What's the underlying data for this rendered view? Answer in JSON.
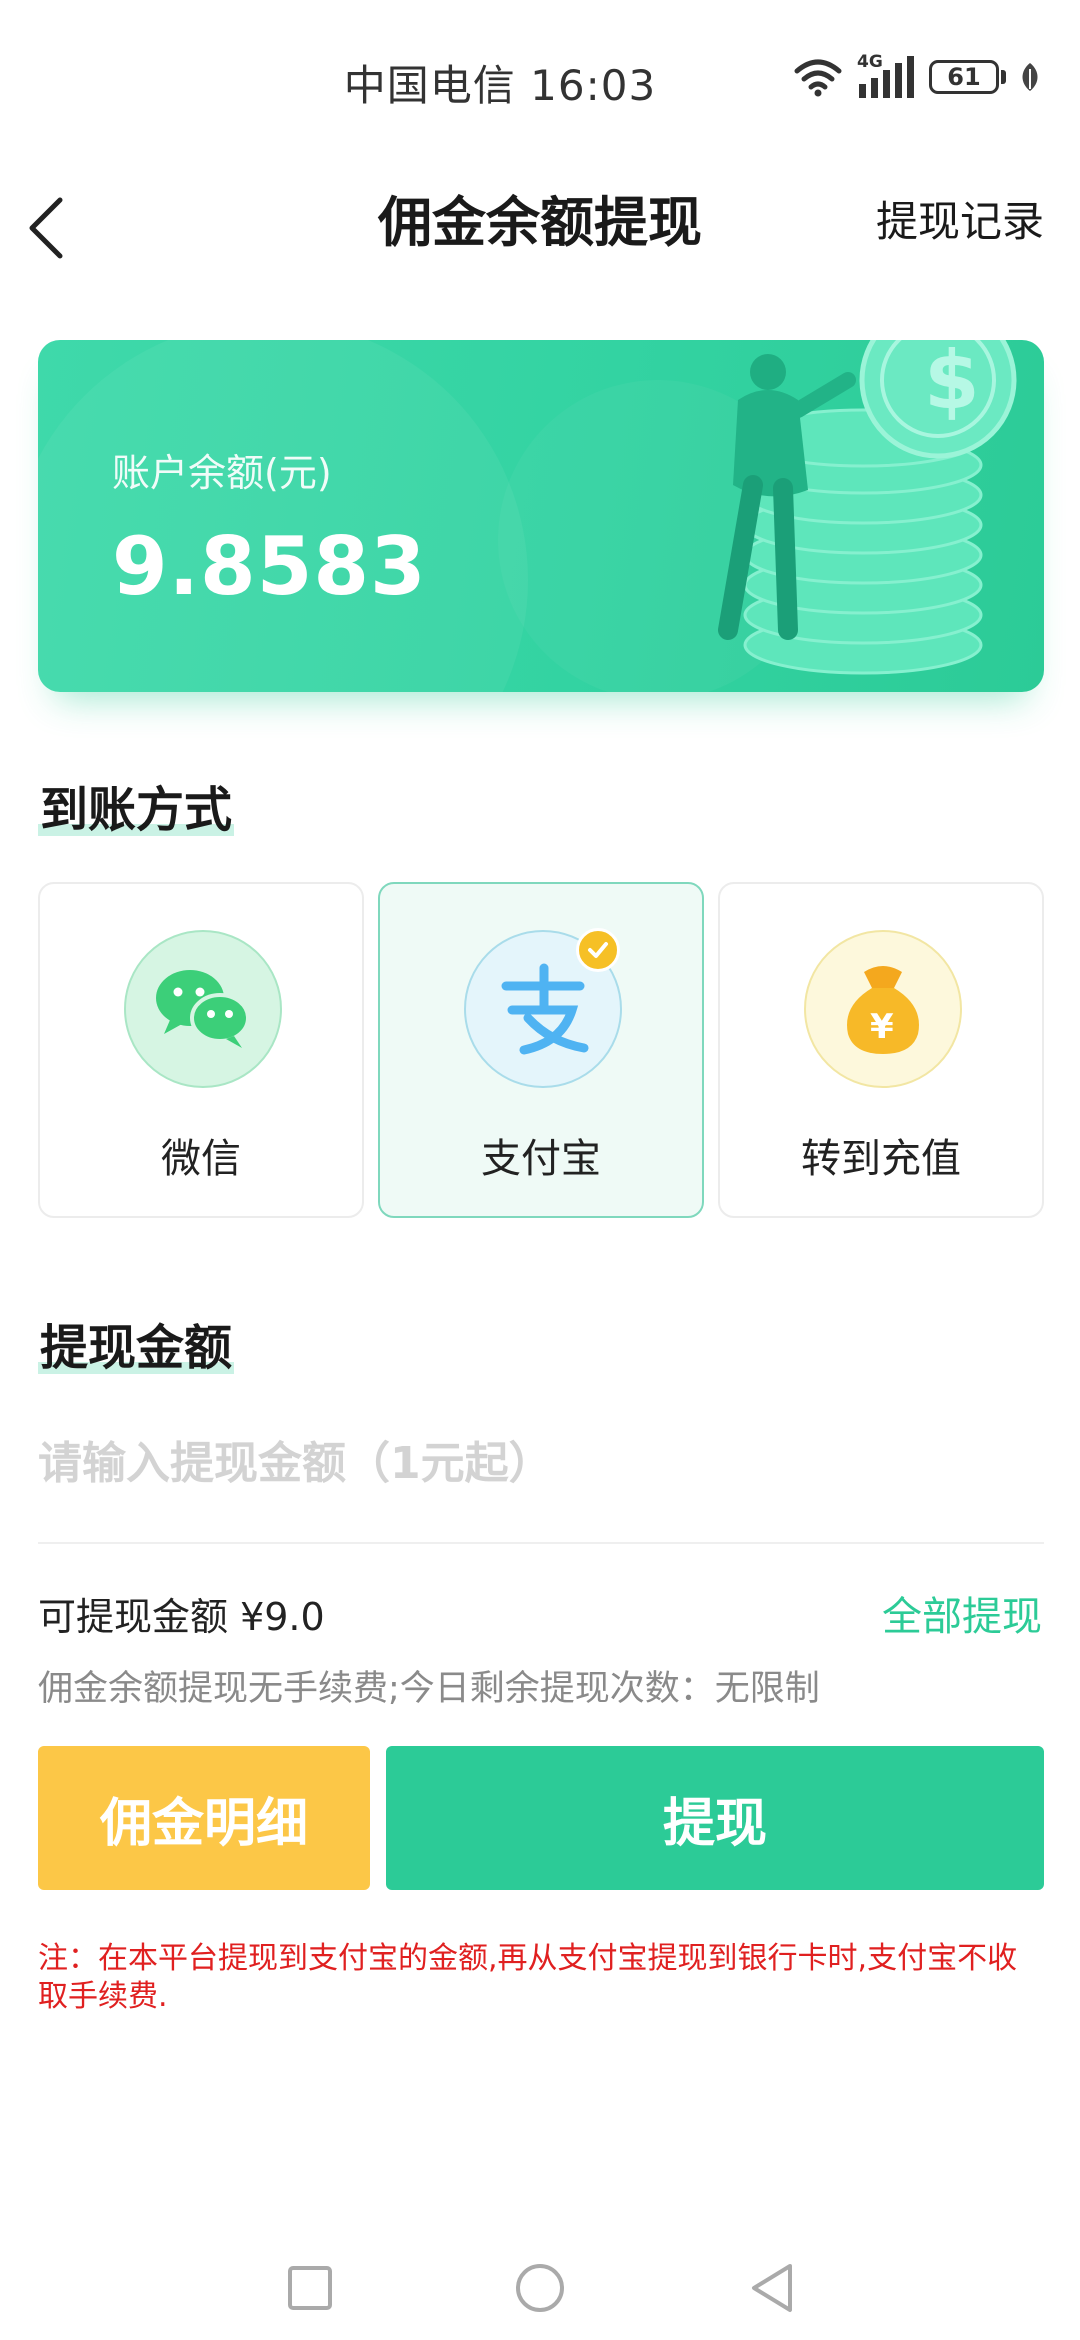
{
  "status_bar": {
    "carrier_time": "中国电信 16:03",
    "network": "4G",
    "battery": "61"
  },
  "header": {
    "title": "佣金余额提现",
    "history_link": "提现记录"
  },
  "balance_card": {
    "label": "账户余额(元)",
    "value": "9.8583"
  },
  "methods": {
    "title": "到账方式",
    "items": [
      {
        "label": "微信",
        "icon": "wechat-icon",
        "selected": false
      },
      {
        "label": "支付宝",
        "icon": "alipay-icon",
        "selected": true
      },
      {
        "label": "转到充值",
        "icon": "money-bag-icon",
        "selected": false
      }
    ]
  },
  "amount": {
    "title": "提现金额",
    "placeholder": "请输入提现金额（1元起）",
    "value": "",
    "available": "可提现金额 ¥9.0",
    "withdraw_all": "全部提现",
    "fee_note": "佣金余额提现无手续费;今日剩余提现次数：无限制"
  },
  "buttons": {
    "detail": "佣金明细",
    "withdraw": "提现"
  },
  "notice": "注：在本平台提现到支付宝的金额,再从支付宝提现到银行卡时,支付宝不收取手续费.",
  "colors": {
    "accent": "#2ccb97",
    "secondary": "#fcc747",
    "warning": "#e02020"
  }
}
